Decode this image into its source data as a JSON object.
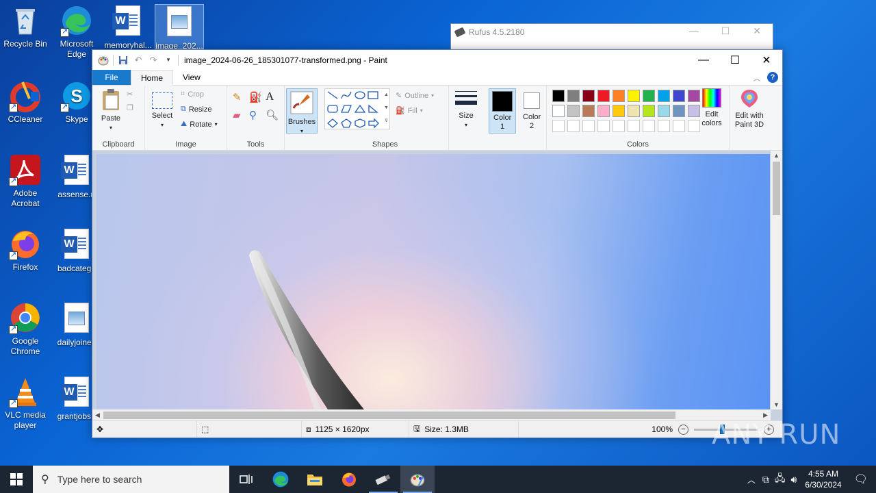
{
  "desktop": {
    "icons": [
      {
        "label": "Recycle Bin"
      },
      {
        "label": "Microsoft Edge"
      },
      {
        "label": "memoryhal..."
      },
      {
        "label": "image_202..."
      },
      {
        "label": "CCleaner"
      },
      {
        "label": "Skype"
      },
      {
        "label": "Adobe Acrobat"
      },
      {
        "label": "assense.rt"
      },
      {
        "label": "Firefox"
      },
      {
        "label": "badcatego"
      },
      {
        "label": "Google Chrome"
      },
      {
        "label": "dailyjoined"
      },
      {
        "label": "VLC media player"
      },
      {
        "label": "grantjobs.r"
      }
    ]
  },
  "rufus": {
    "title": "Rufus 4.5.2180"
  },
  "paint": {
    "title": "image_2024-06-26_185301077-transformed.png - Paint",
    "tabs": [
      "File",
      "Home",
      "View"
    ],
    "clipboard": {
      "paste": "Paste",
      "group": "Clipboard"
    },
    "image": {
      "select": "Select",
      "crop": "Crop",
      "resize": "Resize",
      "rotate": "Rotate",
      "group": "Image"
    },
    "tools": {
      "group": "Tools"
    },
    "brushes": "Brushes",
    "shapes": {
      "outline": "Outline",
      "fill": "Fill",
      "group": "Shapes"
    },
    "size": "Size",
    "color1": "Color 1",
    "color2": "Color 2",
    "colors": {
      "group": "Colors",
      "edit": "Edit colors",
      "row1": [
        "#000000",
        "#7f7f7f",
        "#880015",
        "#ed1c24",
        "#ff7f27",
        "#fff200",
        "#22b14c",
        "#00a2e8",
        "#3f48cc",
        "#a349a4"
      ],
      "row2": [
        "#ffffff",
        "#c3c3c3",
        "#b97a57",
        "#ffaec9",
        "#ffc90e",
        "#efe4b0",
        "#b5e61d",
        "#99d9ea",
        "#7092be",
        "#c8bfe7"
      ]
    },
    "paint3d": "Edit with Paint 3D",
    "status": {
      "dimensions": "1125 × 1620px",
      "size": "Size: 1.3MB",
      "zoom": "100%"
    }
  },
  "taskbar": {
    "search_placeholder": "Type here to search",
    "time": "4:55 AM",
    "date": "6/30/2024"
  },
  "watermark": "ANY RUN"
}
